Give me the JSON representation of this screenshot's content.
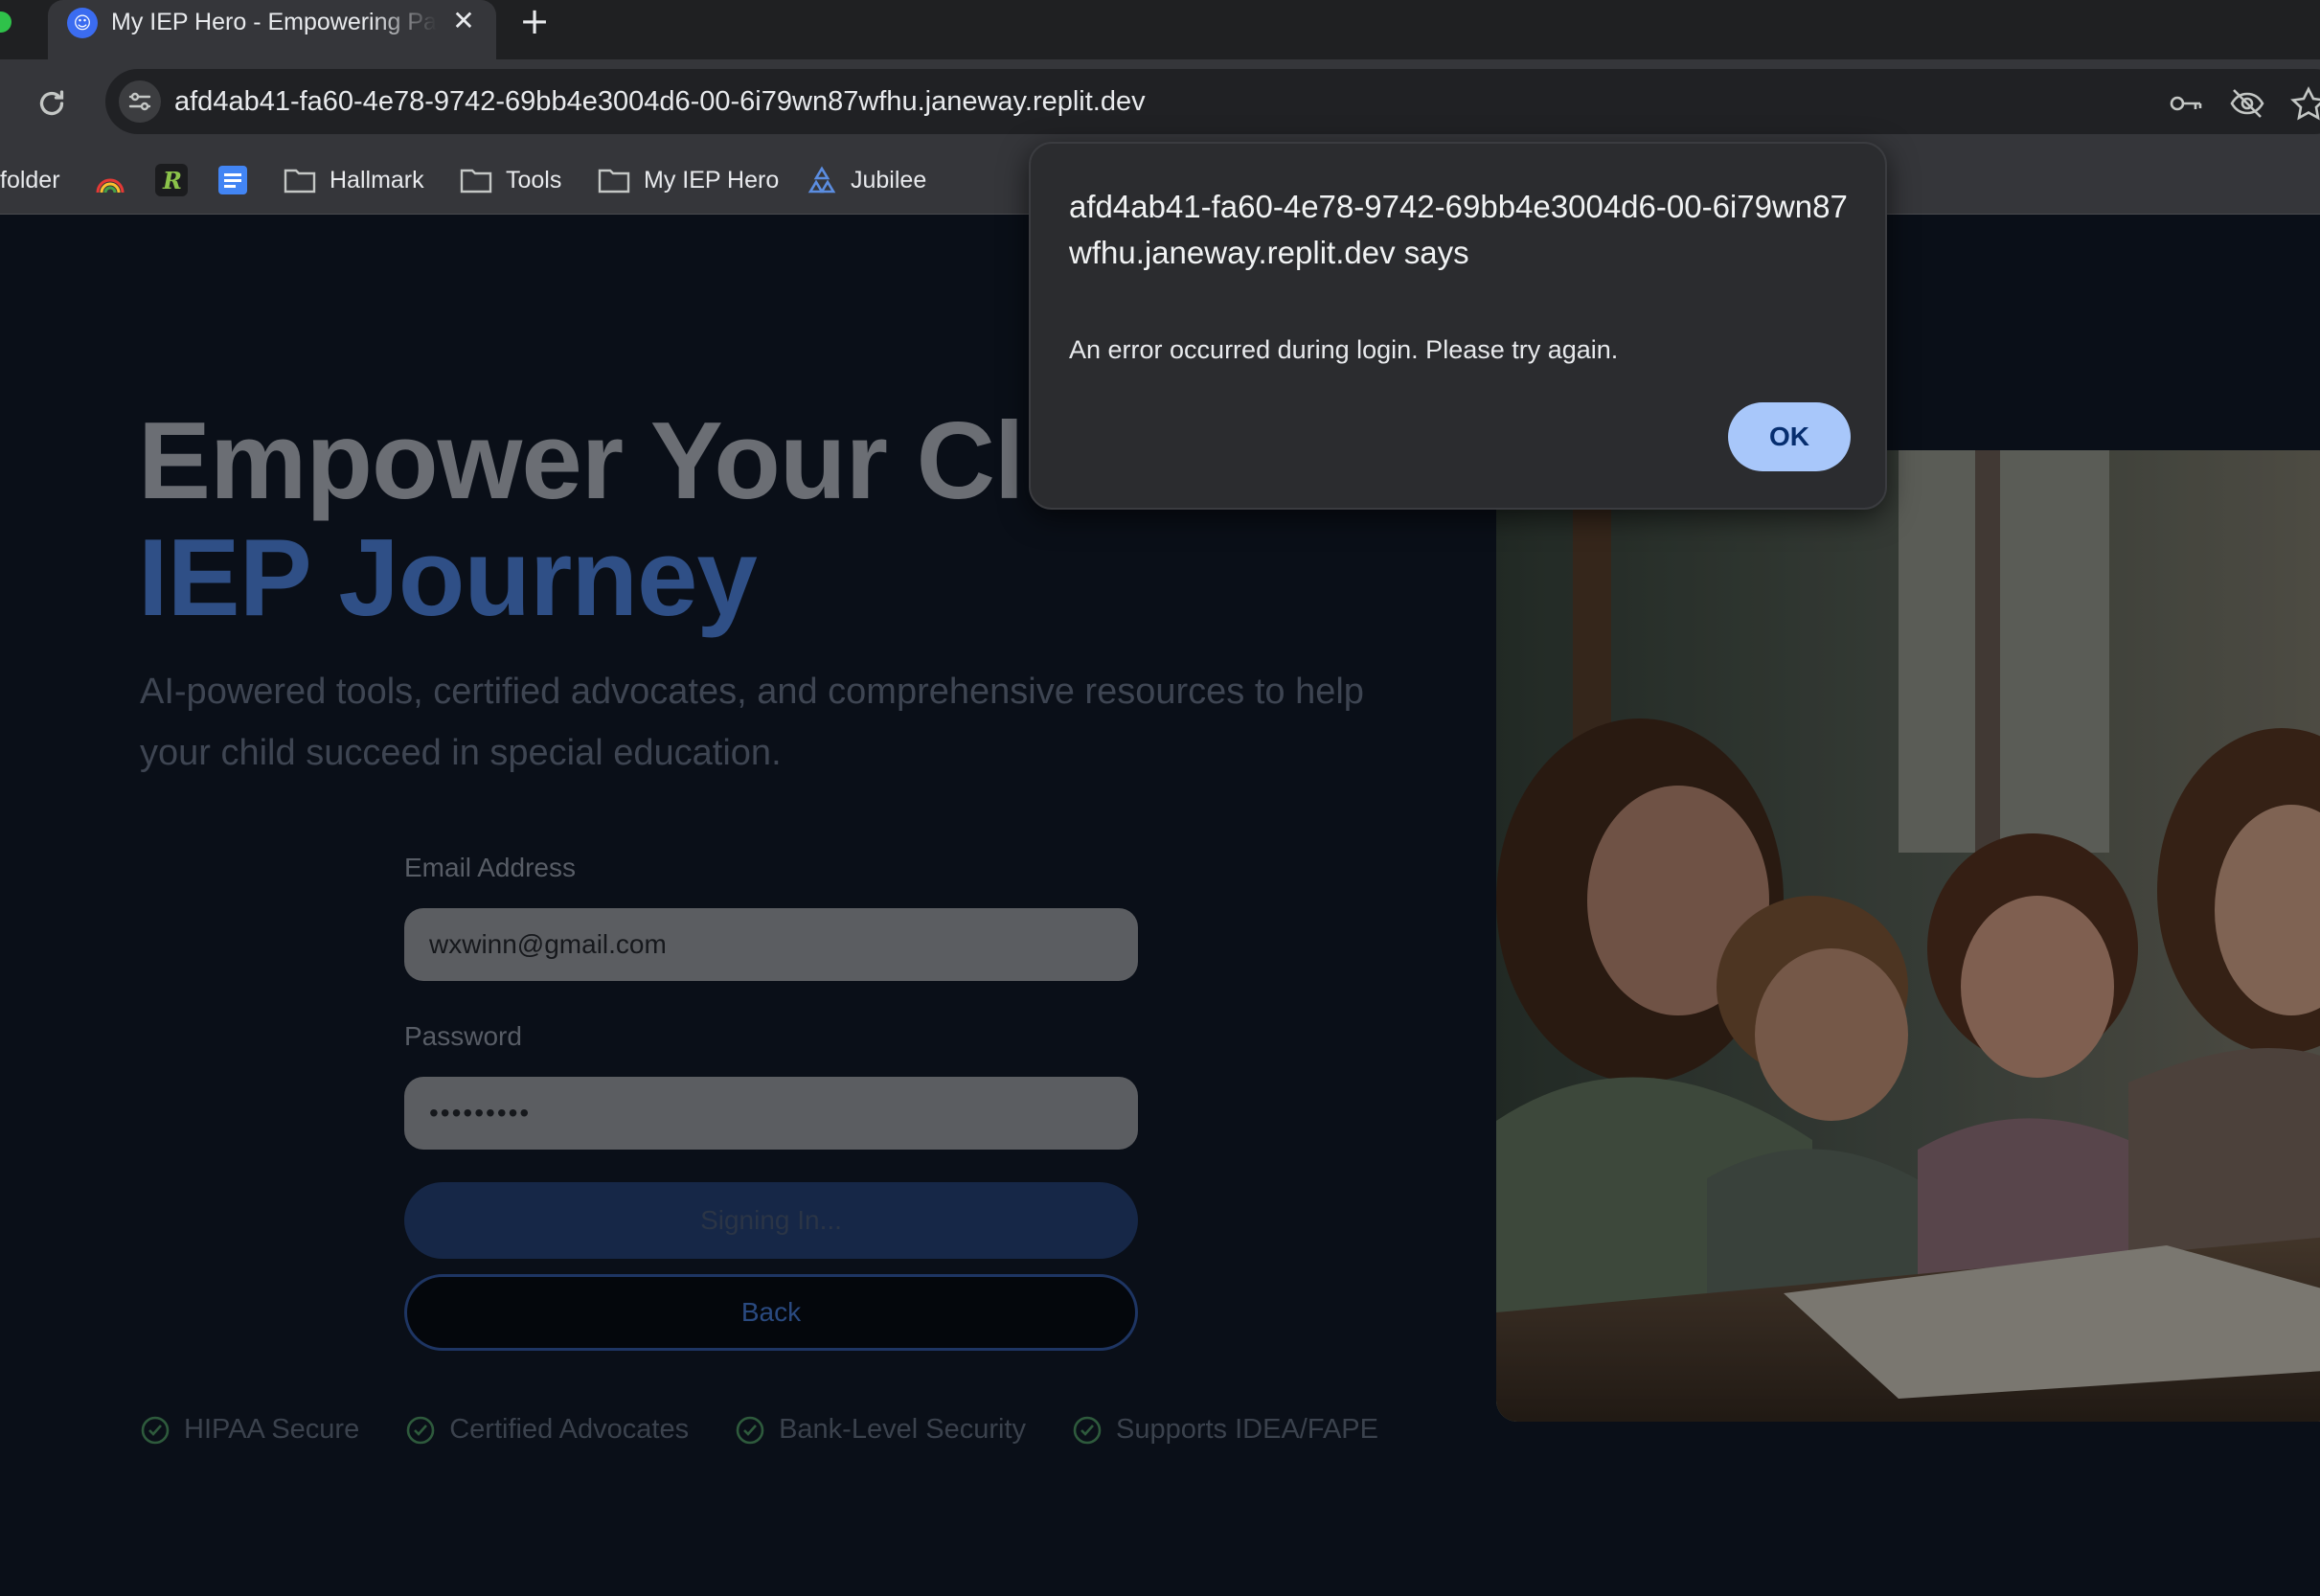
{
  "browser": {
    "tab": {
      "title": "My IEP Hero - Empowering Parents",
      "favicon": "person-icon"
    },
    "new_tab_label": "+",
    "close_tab_label": "✕",
    "url": "afd4ab41-fa60-4e78-9742-69bb4e3004d6-00-6i79wn87wfhu.janeway.replit.dev",
    "bookmarks": {
      "partial_folder": "folder",
      "items": [
        "Hallmark",
        "Tools",
        "My IEP Hero",
        "Jubilee"
      ]
    }
  },
  "page": {
    "hero_line1": "Empower Your Cl",
    "hero_line2": "IEP Journey",
    "subtitle": "AI-powered tools, certified advocates, and comprehensive resources to help your child succeed in special education.",
    "form": {
      "email_label": "Email Address",
      "email_value": "wxwinn@gmail.com",
      "password_label": "Password",
      "password_value": "•••••••••",
      "submit_label": "Signing In...",
      "back_label": "Back"
    },
    "badges": [
      "HIPAA Secure",
      "Certified Advocates",
      "Bank-Level Security",
      "Supports IDEA/FAPE"
    ]
  },
  "dialog": {
    "title": "afd4ab41-fa60-4e78-9742-69bb4e3004d6-00-6i79wn87wfhu.janeway.replit.dev says",
    "message": "An error occurred during login. Please try again.",
    "ok_label": "OK"
  },
  "colors": {
    "accent_blue": "#2f4f86",
    "dialog_button": "#a8c7fa",
    "page_bg": "#0a0f18"
  }
}
